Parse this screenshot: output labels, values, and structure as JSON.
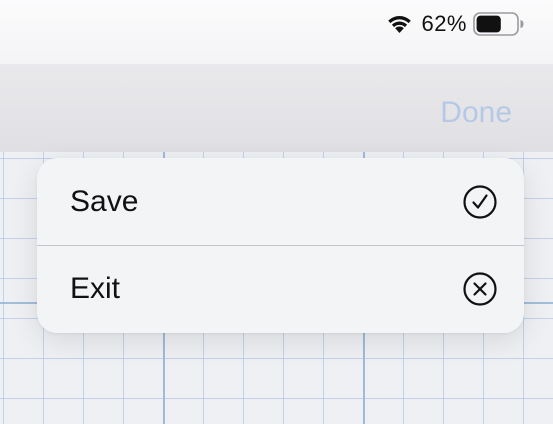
{
  "status_bar": {
    "battery_percent": "62%",
    "battery_level": 0.62,
    "wifi_icon": "wifi-icon",
    "battery_icon": "battery-icon"
  },
  "nav_bar": {
    "done_label": "Done"
  },
  "menu": {
    "items": [
      {
        "label": "Save",
        "icon": "checkmark-circle-icon"
      },
      {
        "label": "Exit",
        "icon": "xmark-circle-icon"
      }
    ]
  },
  "colors": {
    "done_disabled": "#b6c9e4",
    "grid_line": "#afc6e4",
    "menu_background": "#f3f4f6",
    "text": "#111111"
  }
}
